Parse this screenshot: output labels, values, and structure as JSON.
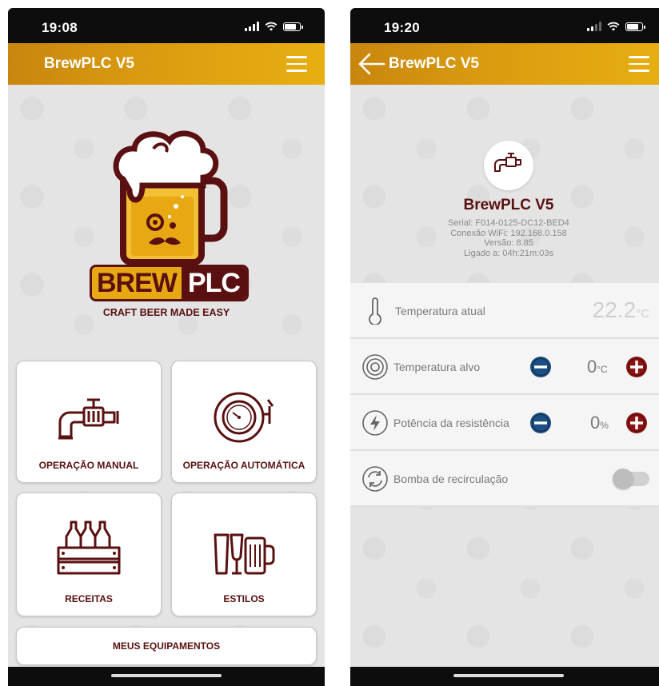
{
  "colors": {
    "brand_gold": "#e8a813",
    "brand_maroon": "#5a1010",
    "minus_blue": "#1e4f82",
    "plus_red": "#8b1414"
  },
  "screen1": {
    "status": {
      "time": "19:08"
    },
    "header": {
      "title": "BrewPLC V5",
      "menu_icon": "hamburger-menu-icon"
    },
    "logo": {
      "brand_left": "BREW",
      "brand_right": "PLC",
      "tagline": "CRAFT BEER MADE EASY"
    },
    "tiles": {
      "manual": {
        "label": "OPERAÇÃO MANUAL",
        "icon": "faucet-icon"
      },
      "auto": {
        "label": "OPERAÇÃO AUTOMÁTICA",
        "icon": "timer-keg-icon"
      },
      "recipes": {
        "label": "RECEITAS",
        "icon": "bottle-crate-icon"
      },
      "styles": {
        "label": "ESTILOS",
        "icon": "glasses-icon"
      },
      "equipment": {
        "label": "MEUS EQUIPAMENTOS"
      }
    }
  },
  "screen2": {
    "status": {
      "time": "19:20"
    },
    "header": {
      "title": "BrewPLC V5",
      "back_icon": "back-arrow-icon",
      "menu_icon": "hamburger-menu-icon"
    },
    "device": {
      "name": "BrewPLC V5",
      "serial": "Serial: F014-0125-DC12-BED4",
      "wifi": "Conexão WiFi: 192.168.0.158",
      "version": "Versão: 8.85",
      "uptime": "Ligado a: 04h:21m:03s"
    },
    "rows": {
      "current_temp": {
        "label": "Temperatura atual",
        "value": "22.2",
        "unit": "°C",
        "icon": "thermometer-icon"
      },
      "target_temp": {
        "label": "Temperatura alvo",
        "value": "0",
        "unit": "°C",
        "icon": "target-icon"
      },
      "power": {
        "label": "Potência da resistência",
        "value": "0",
        "unit": "%",
        "icon": "lightning-icon"
      },
      "pump": {
        "label": "Bomba de recirculação",
        "state": "off",
        "icon": "recirculation-icon"
      }
    }
  }
}
